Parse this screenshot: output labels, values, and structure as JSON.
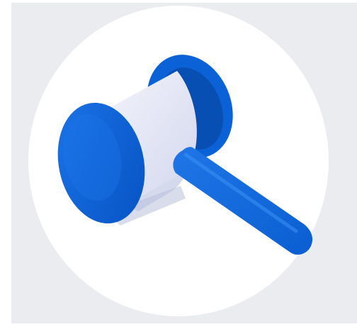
{
  "icon": {
    "name": "gavel-icon",
    "colors": {
      "frame_background": "#ebecf0",
      "badge_background": "#ffffff",
      "gavel_primary": "#0a62d6",
      "gavel_dark": "#084fb3",
      "gavel_light": "#2f86f0",
      "cylinder_body": "#e4e7f6",
      "shadow": "#c9cde3"
    }
  }
}
